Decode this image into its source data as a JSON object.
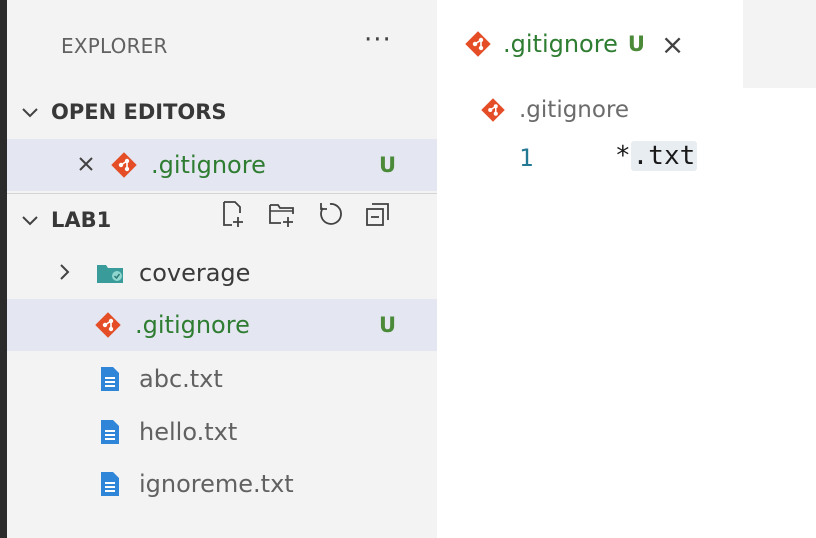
{
  "explorer": {
    "title": "EXPLORER",
    "more_label": "···"
  },
  "open_editors": {
    "title": "OPEN EDITORS",
    "items": [
      {
        "name": ".gitignore",
        "badge": "U"
      }
    ]
  },
  "workspace": {
    "title": "LAB1",
    "items": [
      {
        "name": "coverage",
        "type": "folder"
      },
      {
        "name": ".gitignore",
        "type": "git",
        "badge": "U"
      },
      {
        "name": "abc.txt",
        "type": "file"
      },
      {
        "name": "hello.txt",
        "type": "file"
      },
      {
        "name": "ignoreme.txt",
        "type": "file"
      }
    ]
  },
  "editor": {
    "tab": {
      "name": ".gitignore",
      "badge": "U",
      "close": "×"
    },
    "breadcrumb": ".gitignore",
    "lines": [
      {
        "number": "1",
        "prefix": "*",
        "highlight": ".txt"
      }
    ]
  },
  "colors": {
    "git_accent": "#e44d26",
    "untracked_green": "#4a8a39",
    "file_blue": "#2f86d9",
    "folder_teal": "#3a9c9a",
    "selected_row": "#e4e6f1"
  }
}
